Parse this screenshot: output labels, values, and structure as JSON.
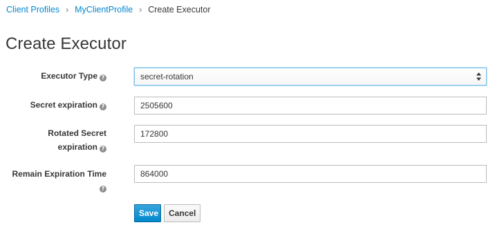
{
  "breadcrumb": {
    "items": [
      "Client Profiles",
      "MyClientProfile"
    ],
    "separator": "›",
    "current": "Create Executor"
  },
  "page": {
    "title": "Create Executor"
  },
  "form": {
    "executor_type": {
      "label": "Executor Type",
      "value": "secret-rotation"
    },
    "secret_expiration": {
      "label": "Secret expiration",
      "value": "2505600"
    },
    "rotated_secret_expiration": {
      "label_line1": "Rotated Secret",
      "label_line2": "expiration",
      "value": "172800"
    },
    "remain_expiration_time": {
      "label": "Remain Expiration Time",
      "value": "864000"
    }
  },
  "buttons": {
    "save": "Save",
    "cancel": "Cancel"
  },
  "icons": {
    "help": "question-circle-icon",
    "select_arrows": "sort-arrows-icon"
  },
  "colors": {
    "link": "#0088ce",
    "primary": "#0088ce",
    "select_focus_border": "#7dc3e8"
  }
}
